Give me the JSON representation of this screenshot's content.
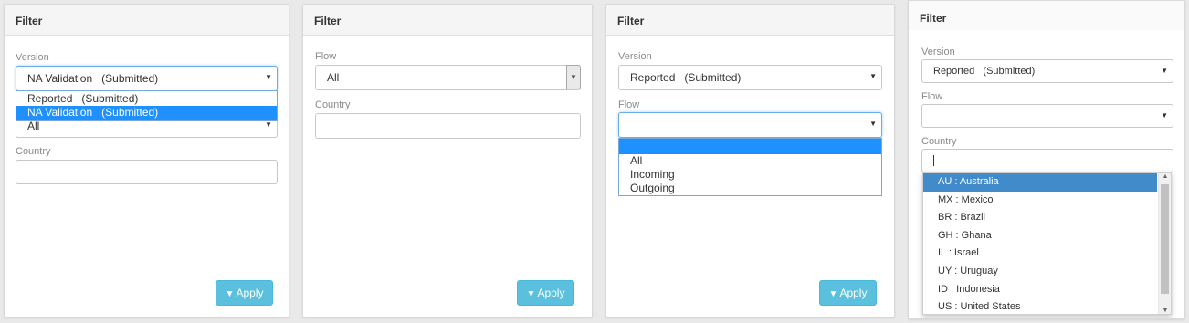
{
  "panel1": {
    "title": "Filter",
    "version_label": "Version",
    "version_value": "NA Validation   (Submitted)",
    "version_options": [
      "Reported   (Submitted)",
      "NA Validation   (Submitted)"
    ],
    "flow_value_partial": "All",
    "country_label": "Country",
    "apply_label": "Apply"
  },
  "panel2": {
    "title": "Filter",
    "flow_label": "Flow",
    "flow_value": "All",
    "country_label": "Country",
    "apply_label": "Apply"
  },
  "panel3": {
    "title": "Filter",
    "version_label": "Version",
    "version_value": "Reported   (Submitted)",
    "flow_label": "Flow",
    "flow_value": "",
    "flow_options": [
      "",
      "All",
      "Incoming",
      "Outgoing"
    ],
    "apply_label": "Apply"
  },
  "panel4": {
    "title": "Filter",
    "version_label": "Version",
    "version_value": "Reported   (Submitted)",
    "flow_label": "Flow",
    "flow_value": "",
    "country_label": "Country",
    "country_value": "",
    "country_options": [
      "AU : Australia",
      "MX : Mexico",
      "BR : Brazil",
      "GH : Ghana",
      "IL : Israel",
      "UY : Uruguay",
      "ID : Indonesia",
      "US : United States"
    ]
  },
  "icons": {
    "caret": "caret-down-icon",
    "filter": "filter-icon"
  },
  "colors": {
    "apply": "#5bc0de",
    "selected": "#1e90ff",
    "selected_alt": "#428bca",
    "focus": "#66afe9"
  }
}
